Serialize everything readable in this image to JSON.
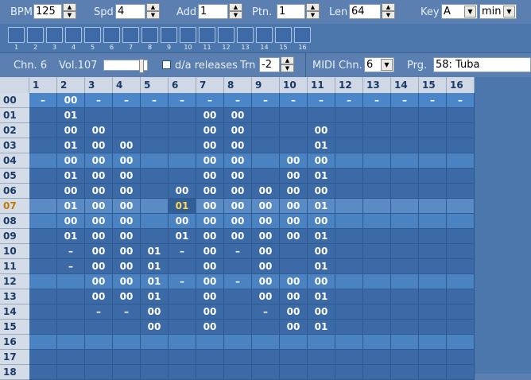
{
  "top": {
    "bpm_label": "BPM",
    "bpm_value": "125",
    "spd_label": "Spd",
    "spd_value": "4",
    "add_label": "Add",
    "add_value": "1",
    "ptn_label": "Ptn.",
    "ptn_value": "1",
    "len_label": "Len",
    "len_value": "64",
    "key_label": "Key",
    "key_value": "A",
    "scale_value": "min"
  },
  "steps": [
    "1",
    "2",
    "3",
    "4",
    "5",
    "6",
    "7",
    "8",
    "9",
    "10",
    "11",
    "12",
    "13",
    "14",
    "15",
    "16"
  ],
  "channel": {
    "chn_label": "Chn. 6",
    "vol_label": "Vol.107",
    "da_label": "d/a releases",
    "trn_label": "Trn",
    "trn_value": "-2",
    "midi_label": "MIDI Chn.",
    "midi_value": "6",
    "prg_label": "Prg.",
    "prg_value": "58: Tuba"
  },
  "grid": {
    "columns": [
      "1",
      "2",
      "3",
      "4",
      "5",
      "6",
      "7",
      "8",
      "9",
      "10",
      "11",
      "12",
      "13",
      "14",
      "15",
      "16"
    ],
    "rows": [
      {
        "label": "00",
        "cells": [
          "–",
          "00",
          "–",
          "–",
          "–",
          "–",
          "–",
          "–",
          "–",
          "–",
          "–",
          "–",
          "–",
          "–",
          "–",
          "–"
        ]
      },
      {
        "label": "01",
        "cells": [
          "",
          "01",
          "",
          "",
          "",
          "",
          "00",
          "00",
          "",
          "",
          "",
          "",
          "",
          "",
          "",
          ""
        ]
      },
      {
        "label": "02",
        "cells": [
          "",
          "00",
          "00",
          "",
          "",
          "",
          "00",
          "00",
          "",
          "",
          "00",
          "",
          "",
          "",
          "",
          ""
        ]
      },
      {
        "label": "03",
        "cells": [
          "",
          "01",
          "00",
          "00",
          "",
          "",
          "00",
          "00",
          "",
          "",
          "01",
          "",
          "",
          "",
          "",
          ""
        ]
      },
      {
        "label": "04",
        "cells": [
          "",
          "00",
          "00",
          "00",
          "",
          "",
          "00",
          "00",
          "",
          "00",
          "00",
          "",
          "",
          "",
          "",
          ""
        ]
      },
      {
        "label": "05",
        "cells": [
          "",
          "01",
          "00",
          "00",
          "",
          "",
          "00",
          "00",
          "",
          "00",
          "01",
          "",
          "",
          "",
          "",
          ""
        ]
      },
      {
        "label": "06",
        "cells": [
          "",
          "00",
          "00",
          "00",
          "",
          "00",
          "00",
          "00",
          "00",
          "00",
          "00",
          "",
          "",
          "",
          "",
          ""
        ]
      },
      {
        "label": "07",
        "cells": [
          "",
          "01",
          "00",
          "00",
          "",
          "01",
          "00",
          "00",
          "00",
          "00",
          "01",
          "",
          "",
          "",
          "",
          ""
        ]
      },
      {
        "label": "08",
        "cells": [
          "",
          "00",
          "00",
          "00",
          "",
          "00",
          "00",
          "00",
          "00",
          "00",
          "00",
          "",
          "",
          "",
          "",
          ""
        ]
      },
      {
        "label": "09",
        "cells": [
          "",
          "01",
          "00",
          "00",
          "",
          "01",
          "00",
          "00",
          "00",
          "00",
          "01",
          "",
          "",
          "",
          "",
          ""
        ]
      },
      {
        "label": "10",
        "cells": [
          "",
          "–",
          "00",
          "00",
          "01",
          "–",
          "00",
          "–",
          "00",
          "",
          "00",
          "",
          "",
          "",
          "",
          ""
        ]
      },
      {
        "label": "11",
        "cells": [
          "",
          "–",
          "00",
          "00",
          "01",
          "",
          "00",
          "",
          "00",
          "",
          "01",
          "",
          "",
          "",
          "",
          ""
        ]
      },
      {
        "label": "12",
        "cells": [
          "",
          "",
          "00",
          "00",
          "01",
          "–",
          "00",
          "–",
          "00",
          "00",
          "00",
          "",
          "",
          "",
          "",
          ""
        ]
      },
      {
        "label": "13",
        "cells": [
          "",
          "",
          "00",
          "00",
          "01",
          "",
          "00",
          "",
          "00",
          "00",
          "01",
          "",
          "",
          "",
          "",
          ""
        ]
      },
      {
        "label": "14",
        "cells": [
          "",
          "",
          "–",
          "–",
          "00",
          "",
          "00",
          "",
          "–",
          "00",
          "00",
          "",
          "",
          "",
          "",
          ""
        ]
      },
      {
        "label": "15",
        "cells": [
          "",
          "",
          "",
          "",
          "00",
          "",
          "00",
          "",
          "",
          "00",
          "01",
          "",
          "",
          "",
          "",
          ""
        ]
      },
      {
        "label": "16",
        "cells": [
          "",
          "",
          "",
          "",
          "",
          "",
          "",
          "",
          "",
          "",
          "",
          "",
          "",
          "",
          "",
          ""
        ]
      },
      {
        "label": "17",
        "cells": [
          "",
          "",
          "",
          "",
          "",
          "",
          "",
          "",
          "",
          "",
          "",
          "",
          "",
          "",
          "",
          ""
        ]
      },
      {
        "label": "18",
        "cells": [
          "",
          "",
          "",
          "",
          "",
          "",
          "",
          "",
          "",
          "",
          "",
          "",
          "",
          "",
          "",
          ""
        ]
      }
    ],
    "highlight": {
      "row": 7,
      "col": 5
    }
  }
}
